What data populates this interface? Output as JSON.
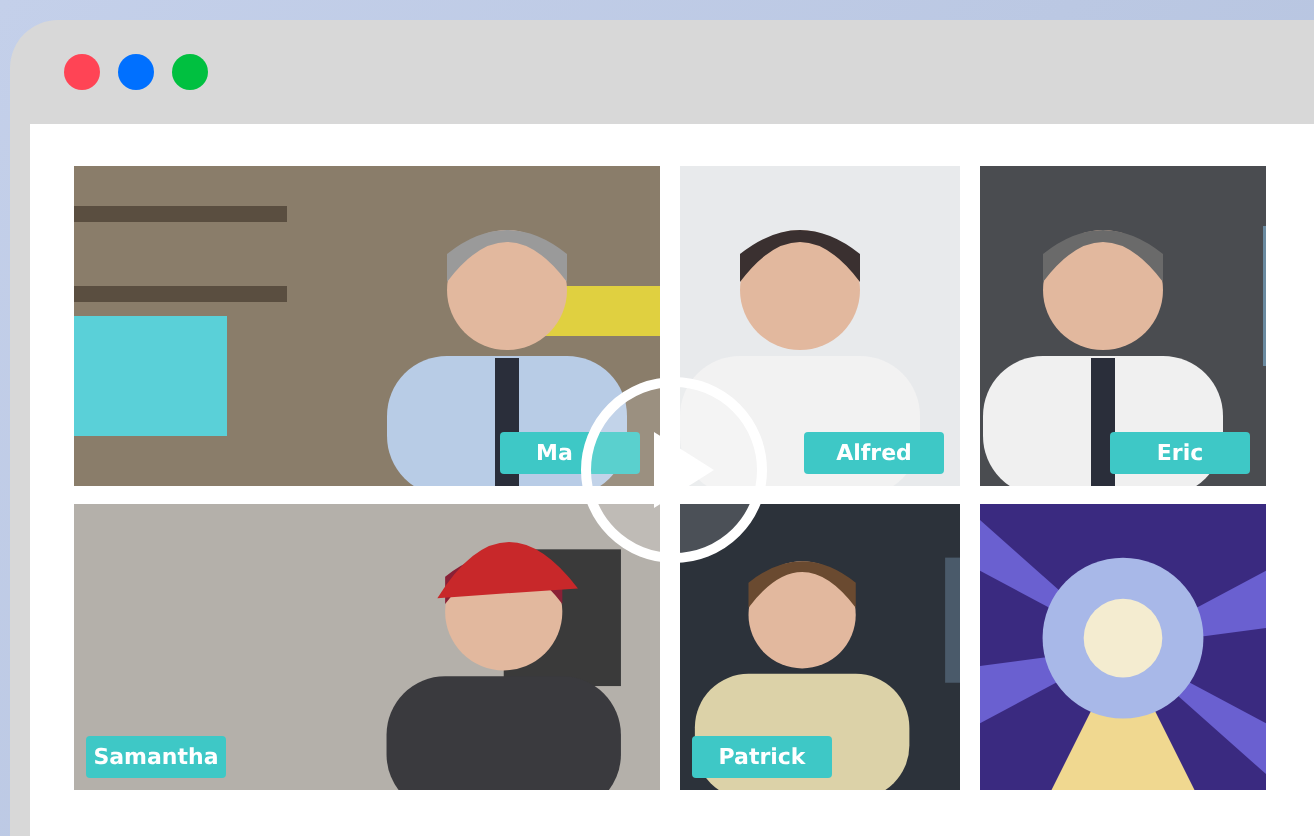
{
  "window": {
    "controls": [
      {
        "color": "#ff4455"
      },
      {
        "color": "#0070ff"
      },
      {
        "color": "#00c040"
      }
    ]
  },
  "tiles": [
    {
      "kind": "video",
      "label": "Ma"
    },
    {
      "kind": "video",
      "label": "Alfred"
    },
    {
      "kind": "video",
      "label": "Eric"
    },
    {
      "kind": "video",
      "label": "Samantha"
    },
    {
      "kind": "video",
      "label": "Patrick"
    },
    {
      "kind": "picture"
    }
  ]
}
